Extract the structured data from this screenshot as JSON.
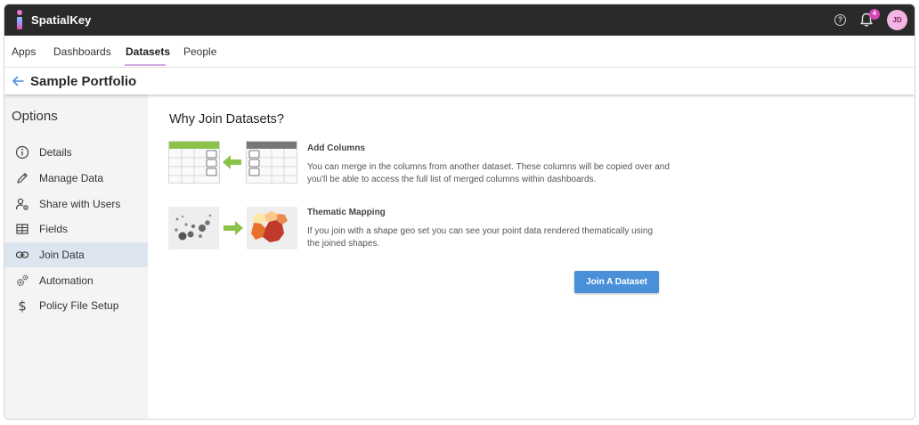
{
  "app": {
    "name": "SpatialKey"
  },
  "topbar": {
    "notification_count": "4",
    "avatar_initials": "JD",
    "help_glyph": "?"
  },
  "nav": {
    "tabs": [
      {
        "label": "Apps"
      },
      {
        "label": "Dashboards"
      },
      {
        "label": "Datasets",
        "active": true
      },
      {
        "label": "People"
      }
    ]
  },
  "page": {
    "title": "Sample Portfolio"
  },
  "sidebar": {
    "heading": "Options",
    "items": [
      {
        "label": "Details",
        "icon": "info-icon"
      },
      {
        "label": "Manage Data",
        "icon": "pencil-icon"
      },
      {
        "label": "Share with Users",
        "icon": "share-users-icon"
      },
      {
        "label": "Fields",
        "icon": "fields-table-icon"
      },
      {
        "label": "Join Data",
        "icon": "link-icon",
        "active": true
      },
      {
        "label": "Automation",
        "icon": "gears-icon"
      },
      {
        "label": "Policy File Setup",
        "icon": "dollar-icon"
      }
    ]
  },
  "main": {
    "heading": "Why Join Datasets?",
    "features": [
      {
        "title": "Add Columns",
        "description": "You can merge in the columns from another dataset. These columns will be copied over and you'll be able to access the full list of merged columns within dashboards."
      },
      {
        "title": "Thematic Mapping",
        "description": "If you join with a shape geo set you can see your point data rendered thematically using the joined shapes."
      }
    ],
    "join_button": "Join A Dataset"
  },
  "colors": {
    "accent": "#4a90d9",
    "topbar": "#2a2a2a",
    "sidebar_active": "#dde6f0",
    "arrow_green": "#8bc34a",
    "brand_pink": "#d946b8"
  }
}
